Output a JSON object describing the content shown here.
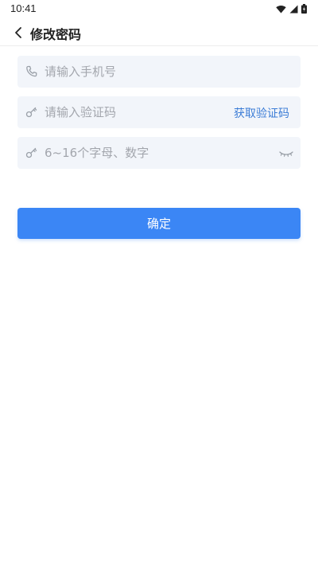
{
  "status_bar": {
    "time": "10:41",
    "icons": [
      "wifi-icon",
      "signal-icon",
      "battery-icon"
    ]
  },
  "app_bar": {
    "back_icon": "chevron-left-icon",
    "title": "修改密码"
  },
  "form": {
    "phone": {
      "icon": "phone-icon",
      "placeholder": "请输入手机号",
      "value": ""
    },
    "code": {
      "icon": "key-icon",
      "placeholder": "请输入验证码",
      "value": "",
      "get_code_label": "获取验证码"
    },
    "password": {
      "icon": "key-icon",
      "placeholder": "6~16个字母、数字",
      "value": "",
      "toggle_icon": "eye-closed-icon"
    }
  },
  "confirm": {
    "label": "确定"
  },
  "colors": {
    "accent": "#3b86f5",
    "link": "#3b7cd6",
    "field_bg": "#f2f5fa",
    "placeholder": "#a3a6ad"
  }
}
